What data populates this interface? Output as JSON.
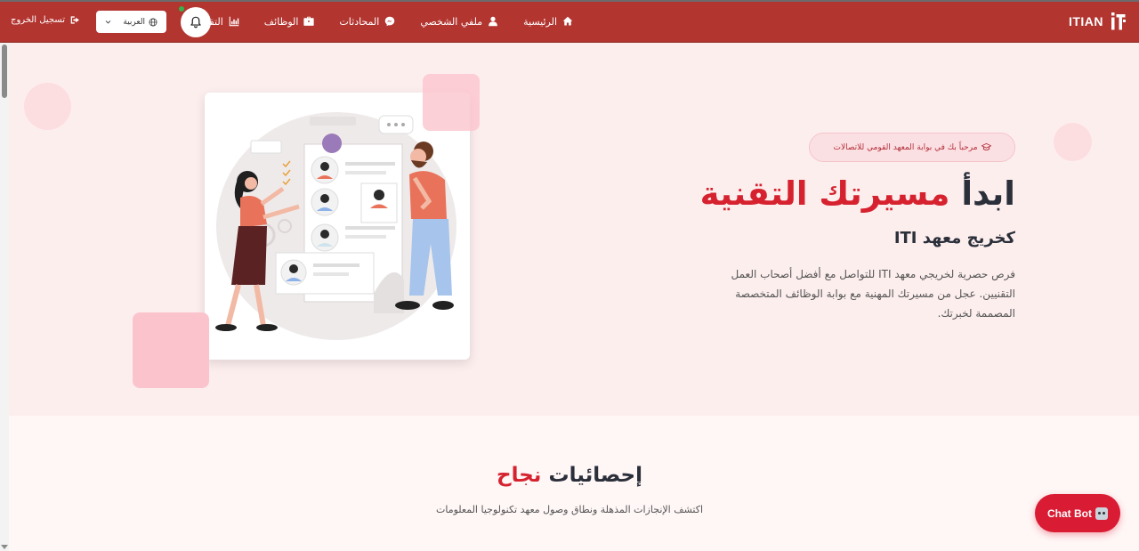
{
  "brand": {
    "name": "ITIAN"
  },
  "nav": {
    "items": [
      {
        "label": "الرئيسية",
        "icon": "home-icon"
      },
      {
        "label": "ملفي الشخصي",
        "icon": "user-icon"
      },
      {
        "label": "المحادثات",
        "icon": "messenger-icon"
      },
      {
        "label": "الوظائف",
        "icon": "briefcase-icon"
      },
      {
        "label": "التقارير",
        "icon": "chart-icon"
      }
    ],
    "language": "العربية",
    "logout_label": "تسجيل الخروج"
  },
  "hero": {
    "badge": "مرحباً بك في بوابة المعهد القومي للاتصالات",
    "title_part1": "ابدأ",
    "title_part2": "مسيرتك التقنية",
    "subtitle": "كخريج معهد ITI",
    "description": "فرص حصرية لخريجي معهد ITI للتواصل مع أفضل أصحاب العمل التقنيين. عجل من مسيرتك المهنية مع بوابة الوظائف المتخصصة المصممة لخبرتك."
  },
  "stats": {
    "title_part1": "إحصائيات",
    "title_part2": "نجاح",
    "subtitle": "اكتشف الإنجازات المذهلة ونطاق وصول معهد تكنولوجيا المعلومات"
  },
  "chatbot": {
    "label": "Chat Bot"
  },
  "colors": {
    "navbar": "#b23530",
    "accent": "#d6222f",
    "hero_bg": "#fdeeee"
  }
}
